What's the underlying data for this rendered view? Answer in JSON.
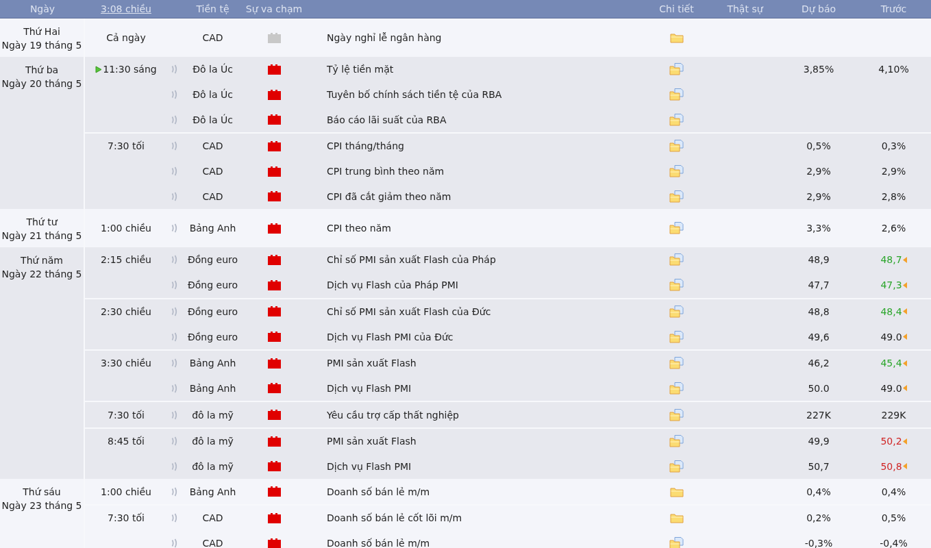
{
  "header": {
    "date": "Ngày",
    "time": "3:08 chiều",
    "currency": "Tiền tệ",
    "impact": "Sự va chạm",
    "detail": "Chi tiết",
    "actual": "Thật sự",
    "forecast": "Dự báo",
    "previous": "Trước"
  },
  "days": [
    {
      "weekday": "Thứ Hai",
      "date": "Ngày 19 tháng 5",
      "groups": [
        {
          "time": "Cả ngày",
          "upcoming": false,
          "events": [
            {
              "currency": "CAD",
              "sound": false,
              "impact": {
                "color": "#c8c8c8"
              },
              "title": "Ngày nghỉ lễ ngân hàng",
              "notes": false
            }
          ]
        }
      ]
    },
    {
      "weekday": "Thứ ba",
      "date": "Ngày 20 tháng 5",
      "groups": [
        {
          "time": "11:30 sáng",
          "upcoming": true,
          "events": [
            {
              "currency": "Đô la Úc",
              "sound": true,
              "impact": {
                "color": "#e00000"
              },
              "title": "Tỷ lệ tiền mặt",
              "notes": true,
              "forecast": "3,85%",
              "previous": {
                "value": "4,10%",
                "color": "#222222",
                "revised": false
              }
            },
            {
              "currency": "Đô la Úc",
              "sound": true,
              "impact": {
                "color": "#e00000"
              },
              "title": "Tuyên bố chính sách tiền tệ của RBA",
              "notes": true
            },
            {
              "currency": "Đô la Úc",
              "sound": true,
              "impact": {
                "color": "#e00000"
              },
              "title": "Báo cáo lãi suất của RBA",
              "notes": true
            }
          ]
        },
        {
          "time": "7:30 tối",
          "upcoming": false,
          "events": [
            {
              "currency": "CAD",
              "sound": true,
              "impact": {
                "color": "#e00000"
              },
              "title": "CPI tháng/tháng",
              "notes": true,
              "forecast": "0,5%",
              "previous": {
                "value": "0,3%",
                "color": "#222222",
                "revised": false
              }
            },
            {
              "currency": "CAD",
              "sound": true,
              "impact": {
                "color": "#e00000"
              },
              "title": "CPI trung bình theo năm",
              "notes": true,
              "forecast": "2,9%",
              "previous": {
                "value": "2,9%",
                "color": "#222222",
                "revised": false
              }
            },
            {
              "currency": "CAD",
              "sound": true,
              "impact": {
                "color": "#e00000"
              },
              "title": "CPI đã cắt giảm theo năm",
              "notes": true,
              "forecast": "2,9%",
              "previous": {
                "value": "2,8%",
                "color": "#222222",
                "revised": false
              }
            }
          ]
        }
      ]
    },
    {
      "weekday": "Thứ tư",
      "date": "Ngày 21 tháng 5",
      "groups": [
        {
          "time": "1:00 chiều",
          "upcoming": false,
          "events": [
            {
              "currency": "Bảng Anh",
              "sound": true,
              "impact": {
                "color": "#e00000"
              },
              "title": "CPI theo năm",
              "notes": true,
              "forecast": "3,3%",
              "previous": {
                "value": "2,6%",
                "color": "#222222",
                "revised": false
              }
            }
          ]
        }
      ]
    },
    {
      "weekday": "Thứ năm",
      "date": "Ngày 22 tháng 5",
      "groups": [
        {
          "time": "2:15 chiều",
          "upcoming": false,
          "events": [
            {
              "currency": "Đồng euro",
              "sound": true,
              "impact": {
                "color": "#e00000"
              },
              "title": "Chỉ số PMI sản xuất Flash của Pháp",
              "notes": true,
              "forecast": "48,9",
              "previous": {
                "value": "48,7",
                "color": "#2aa52a",
                "revised": true
              }
            },
            {
              "currency": "Đồng euro",
              "sound": true,
              "impact": {
                "color": "#e00000"
              },
              "title": "Dịch vụ Flash của Pháp PMI",
              "notes": true,
              "forecast": "47,7",
              "previous": {
                "value": "47,3",
                "color": "#2aa52a",
                "revised": true
              }
            }
          ]
        },
        {
          "time": "2:30 chiều",
          "upcoming": false,
          "events": [
            {
              "currency": "Đồng euro",
              "sound": true,
              "impact": {
                "color": "#e00000"
              },
              "title": "Chỉ số PMI sản xuất Flash của Đức",
              "notes": true,
              "forecast": "48,8",
              "previous": {
                "value": "48,4",
                "color": "#2aa52a",
                "revised": true
              }
            },
            {
              "currency": "Đồng euro",
              "sound": true,
              "impact": {
                "color": "#e00000"
              },
              "title": "Dịch vụ Flash PMI của Đức",
              "notes": true,
              "forecast": "49,6",
              "previous": {
                "value": "49.0",
                "color": "#222222",
                "revised": true
              }
            }
          ]
        },
        {
          "time": "3:30 chiều",
          "upcoming": false,
          "events": [
            {
              "currency": "Bảng Anh",
              "sound": true,
              "impact": {
                "color": "#e00000"
              },
              "title": "PMI sản xuất Flash",
              "notes": true,
              "forecast": "46,2",
              "previous": {
                "value": "45,4",
                "color": "#2aa52a",
                "revised": true
              }
            },
            {
              "currency": "Bảng Anh",
              "sound": true,
              "impact": {
                "color": "#e00000"
              },
              "title": "Dịch vụ Flash PMI",
              "notes": true,
              "forecast": "50.0",
              "previous": {
                "value": "49.0",
                "color": "#222222",
                "revised": true
              }
            }
          ]
        },
        {
          "time": "7:30 tối",
          "upcoming": false,
          "events": [
            {
              "currency": "đô la mỹ",
              "sound": true,
              "impact": {
                "color": "#e00000"
              },
              "title": "Yêu cầu trợ cấp thất nghiệp",
              "notes": true,
              "forecast": "227K",
              "previous": {
                "value": "229K",
                "color": "#222222",
                "revised": false
              }
            }
          ]
        },
        {
          "time": "8:45 tối",
          "upcoming": false,
          "events": [
            {
              "currency": "đô la mỹ",
              "sound": true,
              "impact": {
                "color": "#e00000"
              },
              "title": "PMI sản xuất Flash",
              "notes": true,
              "forecast": "49,9",
              "previous": {
                "value": "50,2",
                "color": "#d02525",
                "revised": true
              }
            },
            {
              "currency": "đô la mỹ",
              "sound": true,
              "impact": {
                "color": "#e00000"
              },
              "title": "Dịch vụ Flash PMI",
              "notes": true,
              "forecast": "50,7",
              "previous": {
                "value": "50,8",
                "color": "#d02525",
                "revised": true
              }
            }
          ]
        }
      ]
    },
    {
      "weekday": "Thứ sáu",
      "date": "Ngày 23 tháng 5",
      "groups": [
        {
          "time": "1:00 chiều",
          "upcoming": false,
          "events": [
            {
              "currency": "Bảng Anh",
              "sound": true,
              "impact": {
                "color": "#e00000"
              },
              "title": "Doanh số bán lẻ m/m",
              "notes": false,
              "forecast": "0,4%",
              "previous": {
                "value": "0,4%",
                "color": "#222222",
                "revised": false
              }
            }
          ]
        },
        {
          "time": "7:30 tối",
          "upcoming": false,
          "events": [
            {
              "currency": "CAD",
              "sound": true,
              "impact": {
                "color": "#e00000"
              },
              "title": "Doanh số bán lẻ cốt lõi m/m",
              "notes": false,
              "forecast": "0,2%",
              "previous": {
                "value": "0,5%",
                "color": "#222222",
                "revised": false
              }
            },
            {
              "currency": "CAD",
              "sound": true,
              "impact": {
                "color": "#e00000"
              },
              "title": "Doanh số bán lẻ m/m",
              "notes": true,
              "forecast": "-0,3%",
              "previous": {
                "value": "-0,4%",
                "color": "#222222",
                "revised": false
              }
            }
          ]
        }
      ]
    }
  ]
}
